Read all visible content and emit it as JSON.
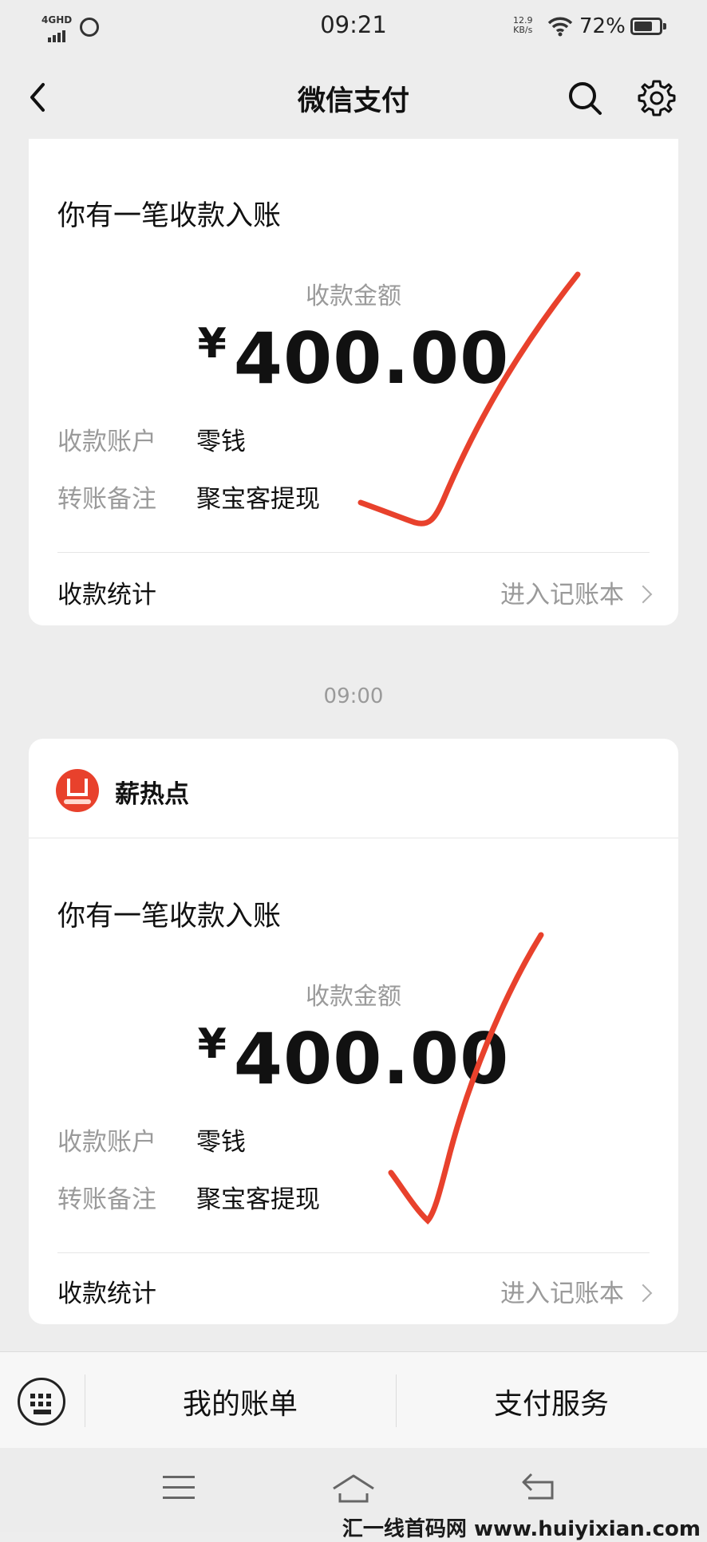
{
  "status_bar": {
    "network": "4GHD",
    "time": "09:21",
    "speed_value": "12.9",
    "speed_unit": "KB/s",
    "battery_percent": "72%",
    "battery_level": 0.72
  },
  "nav": {
    "title": "微信支付"
  },
  "payments": [
    {
      "notice": "你有一笔收款入账",
      "amount_label": "收款金额",
      "currency": "¥",
      "amount": "400.00",
      "account_label": "收款账户",
      "account_value": "零钱",
      "remark_label": "转账备注",
      "remark_value": "聚宝客提现",
      "stat_label": "收款统计",
      "ledger_link": "进入记账本"
    },
    {
      "merchant": "薪热点",
      "notice": "你有一笔收款入账",
      "amount_label": "收款金额",
      "currency": "¥",
      "amount": "400.00",
      "account_label": "收款账户",
      "account_value": "零钱",
      "remark_label": "转账备注",
      "remark_value": "聚宝客提现",
      "stat_label": "收款统计",
      "ledger_link": "进入记账本"
    }
  ],
  "timestamp": "09:00",
  "bottom_bar": {
    "my_bill": "我的账单",
    "pay_service": "支付服务"
  },
  "watermark": "汇一线首码网 www.huiyixian.com",
  "colors": {
    "background": "#ededed",
    "card": "#ffffff",
    "check_mark": "#e8412c",
    "merchant_logo": "#e8412c"
  },
  "icons": [
    "back-icon",
    "search-icon",
    "gear-icon",
    "keyboard-icon",
    "sys-menu-icon",
    "sys-home-icon",
    "sys-back-icon"
  ]
}
